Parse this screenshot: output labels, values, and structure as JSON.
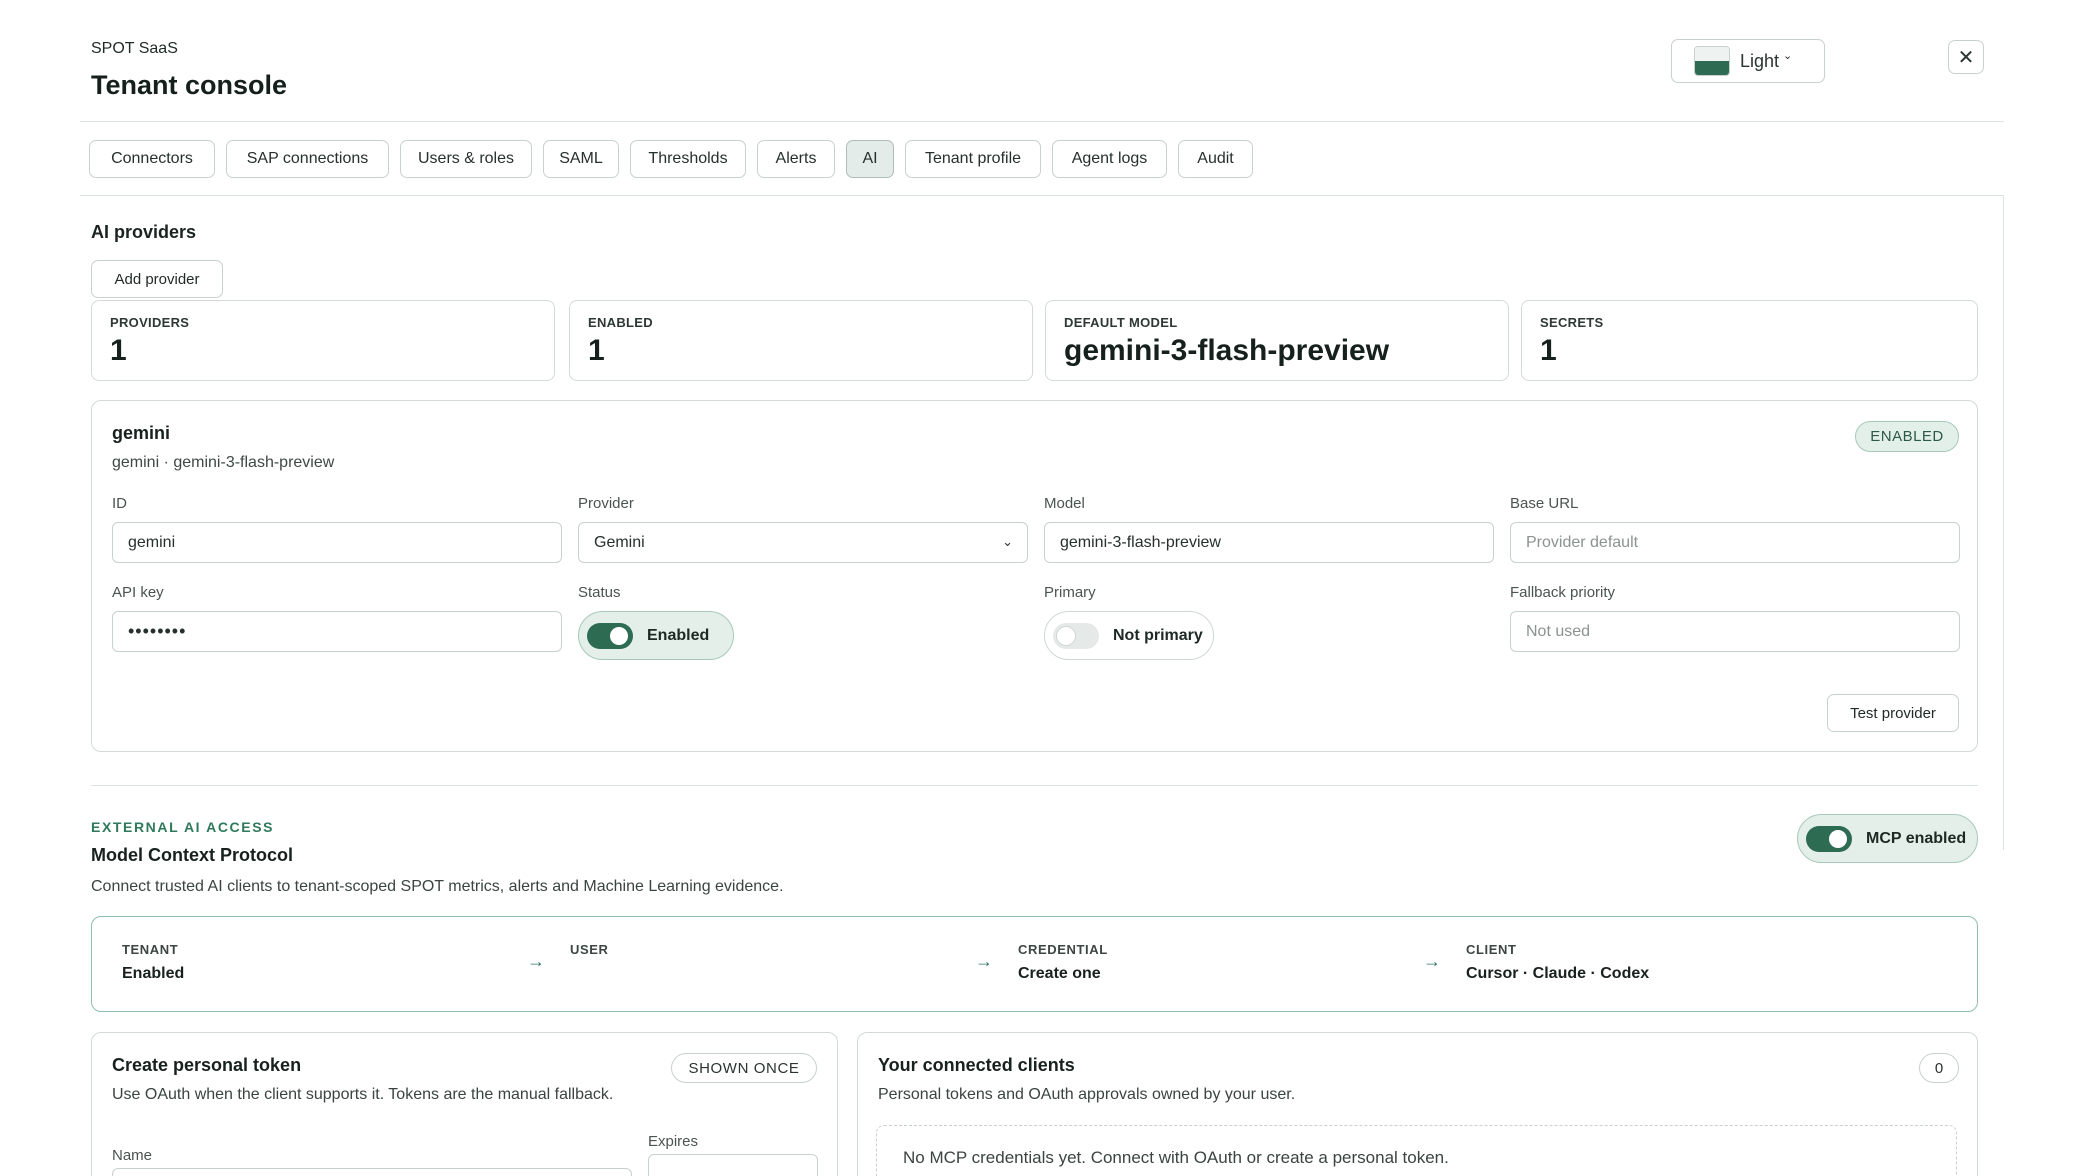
{
  "header": {
    "brand": "SPOT SaaS",
    "title": "Tenant console",
    "theme": {
      "label": "Light",
      "icon": "theme-swatch-icon"
    },
    "close_icon": "close-icon"
  },
  "tabs": [
    {
      "label": "Connectors"
    },
    {
      "label": "SAP connections"
    },
    {
      "label": "Users & roles"
    },
    {
      "label": "SAML"
    },
    {
      "label": "Thresholds"
    },
    {
      "label": "Alerts"
    },
    {
      "label": "AI",
      "active": true
    },
    {
      "label": "Tenant profile"
    },
    {
      "label": "Agent logs"
    },
    {
      "label": "Audit"
    }
  ],
  "ai": {
    "heading": "AI providers",
    "add_provider": "Add provider",
    "stats": [
      {
        "label": "PROVIDERS",
        "value": "1"
      },
      {
        "label": "ENABLED",
        "value": "1"
      },
      {
        "label": "DEFAULT MODEL",
        "value": "gemini-3-flash-preview"
      },
      {
        "label": "SECRETS",
        "value": "1"
      }
    ],
    "provider": {
      "name": "gemini",
      "subtitle": "gemini · gemini-3-flash-preview",
      "badge": "ENABLED",
      "fields": {
        "id": {
          "label": "ID",
          "value": "gemini"
        },
        "provider": {
          "label": "Provider",
          "value": "Gemini"
        },
        "model": {
          "label": "Model",
          "value": "gemini-3-flash-preview"
        },
        "base_url": {
          "label": "Base URL",
          "placeholder": "Provider default"
        },
        "api_key": {
          "label": "API key",
          "value": "••••••••"
        },
        "status": {
          "label": "Status",
          "value": "Enabled"
        },
        "primary": {
          "label": "Primary",
          "value": "Not primary"
        },
        "fallback": {
          "label": "Fallback priority",
          "placeholder": "Not used"
        }
      },
      "test_button": "Test provider"
    }
  },
  "mcp": {
    "eyebrow": "EXTERNAL AI ACCESS",
    "title": "Model Context Protocol",
    "description": "Connect trusted AI clients to tenant-scoped SPOT metrics, alerts and Machine Learning evidence.",
    "toggle_label": "MCP enabled",
    "flow": [
      {
        "label": "TENANT",
        "value": "Enabled"
      },
      {
        "label": "USER",
        "value": ""
      },
      {
        "label": "CREDENTIAL",
        "value": "Create one"
      },
      {
        "label": "CLIENT",
        "value": "Cursor · Claude · Codex"
      }
    ],
    "arrow": "→",
    "token_card": {
      "title": "Create personal token",
      "badge": "SHOWN ONCE",
      "description": "Use OAuth when the client supports it. Tokens are the manual fallback.",
      "name_label": "Name",
      "expires_label": "Expires"
    },
    "clients_card": {
      "title": "Your connected clients",
      "count": "0",
      "description": "Personal tokens and OAuth approvals owned by your user.",
      "empty_text": "No MCP credentials yet. Connect with OAuth or create a personal token."
    }
  },
  "colors": {
    "accent": "#2e6b53",
    "accent_text": "#2f7a5d",
    "border": "#c9d1cd"
  }
}
